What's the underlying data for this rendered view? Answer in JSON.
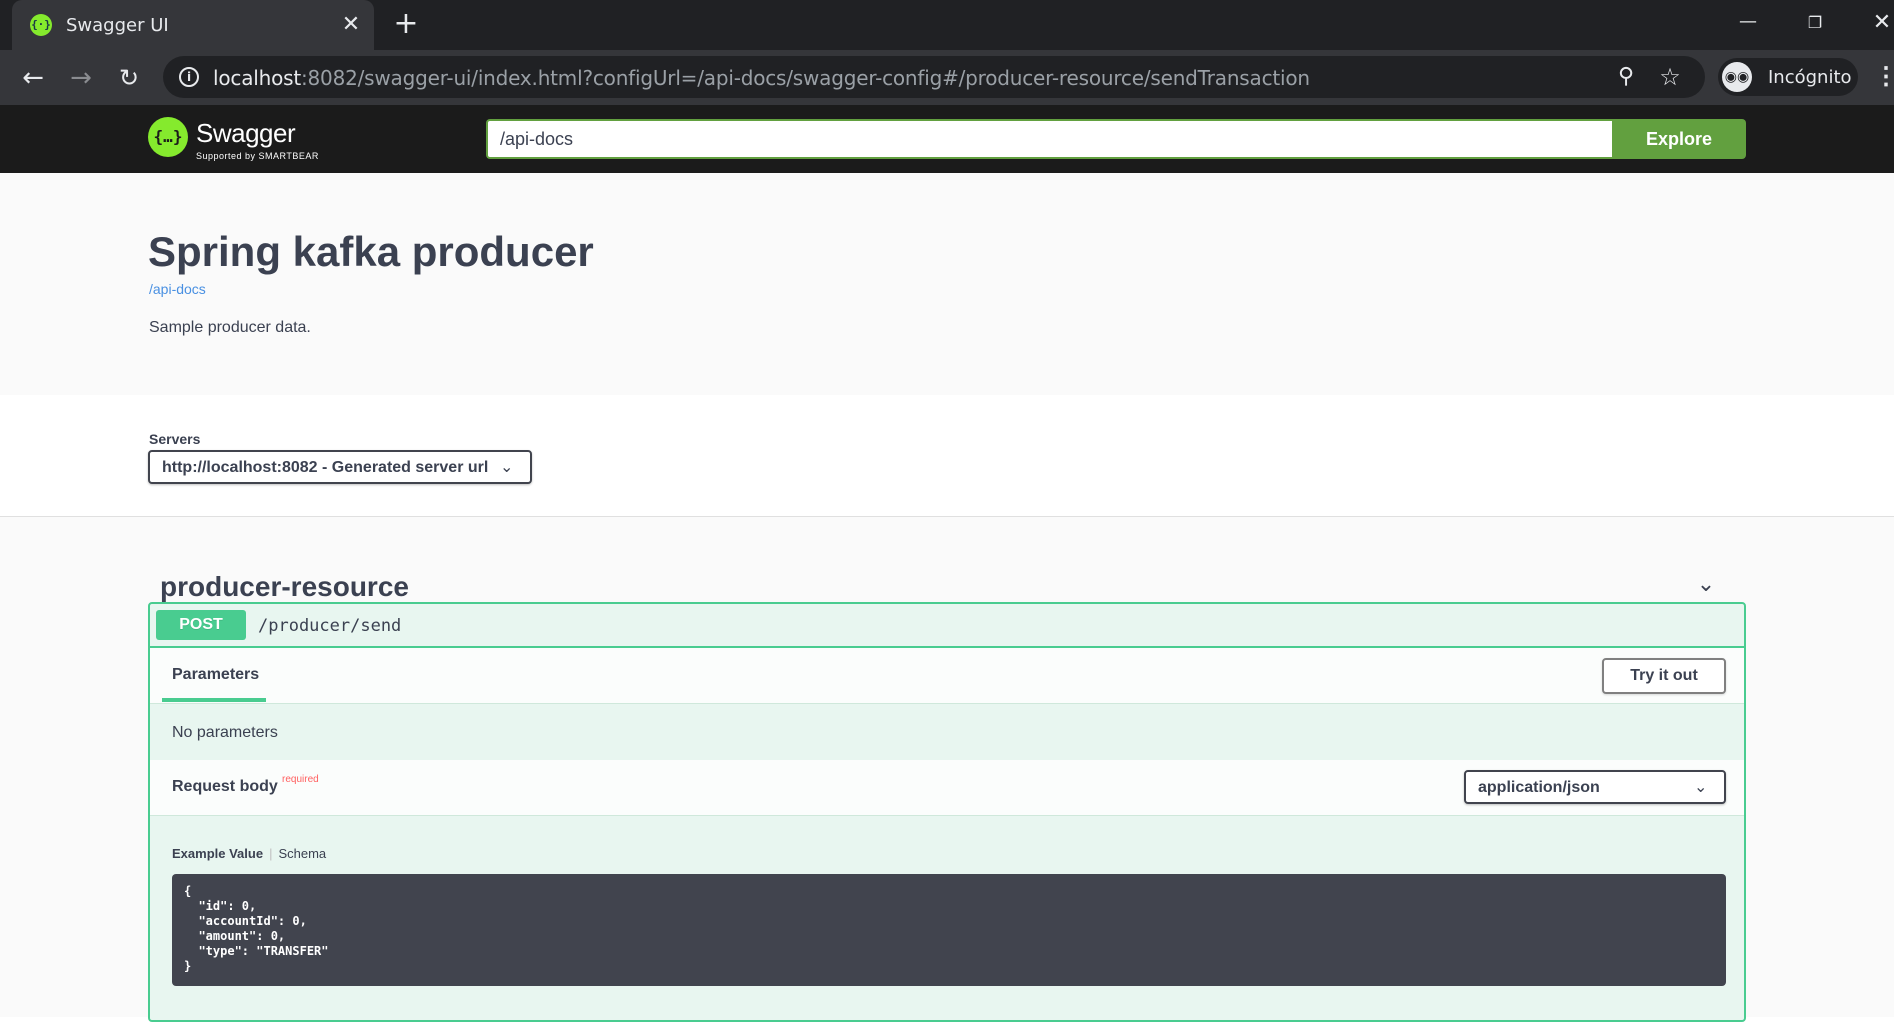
{
  "browser": {
    "tab_title": "Swagger UI",
    "tab_close": "✕",
    "new_tab": "+",
    "url_host": "localhost",
    "url_rest": ":8082/swagger-ui/index.html?configUrl=/api-docs/swagger-config#/producer-resource/sendTransaction",
    "profile_label": "Incógnito",
    "icons": [
      "back-arrow-icon",
      "forward-arrow-icon",
      "reload-icon",
      "info-icon",
      "zoom-icon",
      "star-icon",
      "incognito-icon",
      "menu-icon"
    ]
  },
  "swagger_topbar": {
    "logo_text": "Swagger",
    "logo_sub": "Supported by SMARTBEAR",
    "spec_url": "/api-docs",
    "explore_label": "Explore",
    "accent_color": "#62a03f"
  },
  "info": {
    "title": "Spring kafka producer",
    "spec_link": "/api-docs",
    "description": "Sample producer data."
  },
  "servers": {
    "label": "Servers",
    "selected": "http://localhost:8082 - Generated server url"
  },
  "tag": {
    "name": "producer-resource"
  },
  "operation": {
    "method": "POST",
    "path": "/producer/send",
    "method_color": "#49cc90",
    "parameters_tab": "Parameters",
    "try_it_out": "Try it out",
    "no_parameters": "No parameters",
    "request_body_label": "Request body",
    "required_label": "required",
    "content_type": "application/json",
    "example_value_tab": "Example Value",
    "schema_tab": "Schema",
    "example_lines": [
      "{",
      "  \"id\": 0,",
      "  \"accountId\": 0,",
      "  \"amount\": 0,",
      "  \"type\": \"TRANSFER\"",
      "}"
    ]
  }
}
